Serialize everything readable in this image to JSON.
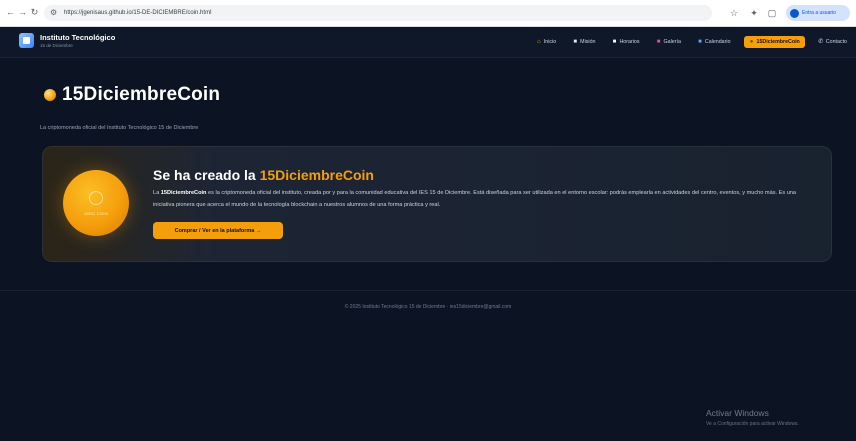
{
  "browser": {
    "url": "https://jgenisaus.github.io/15-DE-DICIEMBRE/coin.html",
    "profile_label": "Entra a usuario",
    "icons": [
      "back-icon",
      "forward-icon",
      "reload-icon",
      "tune-icon",
      "star-icon",
      "extensions-icon",
      "window-icon"
    ]
  },
  "header": {
    "title": "Instituto Tecnológico",
    "subtitle": "15 de Diciembre",
    "nav": [
      {
        "icon": "home-icon",
        "label": "Inicio"
      },
      {
        "icon": "target-icon",
        "label": "Misión"
      },
      {
        "icon": "book-icon",
        "label": "Horarios"
      },
      {
        "icon": "image-icon",
        "label": "Galería"
      },
      {
        "icon": "calendar-icon",
        "label": "Calendario"
      },
      {
        "icon": "coin-icon",
        "label": "15DiciembreCoin",
        "active": true
      },
      {
        "icon": "phone-icon",
        "label": "Contacto"
      }
    ]
  },
  "main": {
    "title": "15DiciembreCoin",
    "subtitle": "La criptomoneda oficial del Instituto Tecnológico 15 de Diciembre",
    "card": {
      "coin_label": "15DC COIN",
      "heading_prefix": "Se ha creado la ",
      "heading_accent": "15DiciembreCoin",
      "text_prefix": "La ",
      "text_bold": "15DiciembreCoin",
      "text_rest": " es la criptomoneda oficial del instituto, creada por y para la comunidad educativa del IES 15 de Diciembre. Está diseñada para ser utilizada en el entorno escolar: podrás emplearla en actividades del centro, eventos, y mucho más. Es una iniciativa pionera que acerca el mundo de la tecnología blockchain a nuestros alumnos de una forma práctica y real.",
      "button_label": "Comprar / Ver en la plataforma →"
    }
  },
  "footer": {
    "text": "© 2025 Instituto Tecnológico 15 de Diciembre · ies15diciembre@gmail.com"
  },
  "windows_watermark": {
    "line1": "Activar Windows",
    "line2": "Ve a Configuración para activar Windows."
  },
  "colors": {
    "accent": "#f59e0b",
    "page_background": "#0c1423",
    "header_background": "#0f1829",
    "card_background": "#19222f"
  }
}
